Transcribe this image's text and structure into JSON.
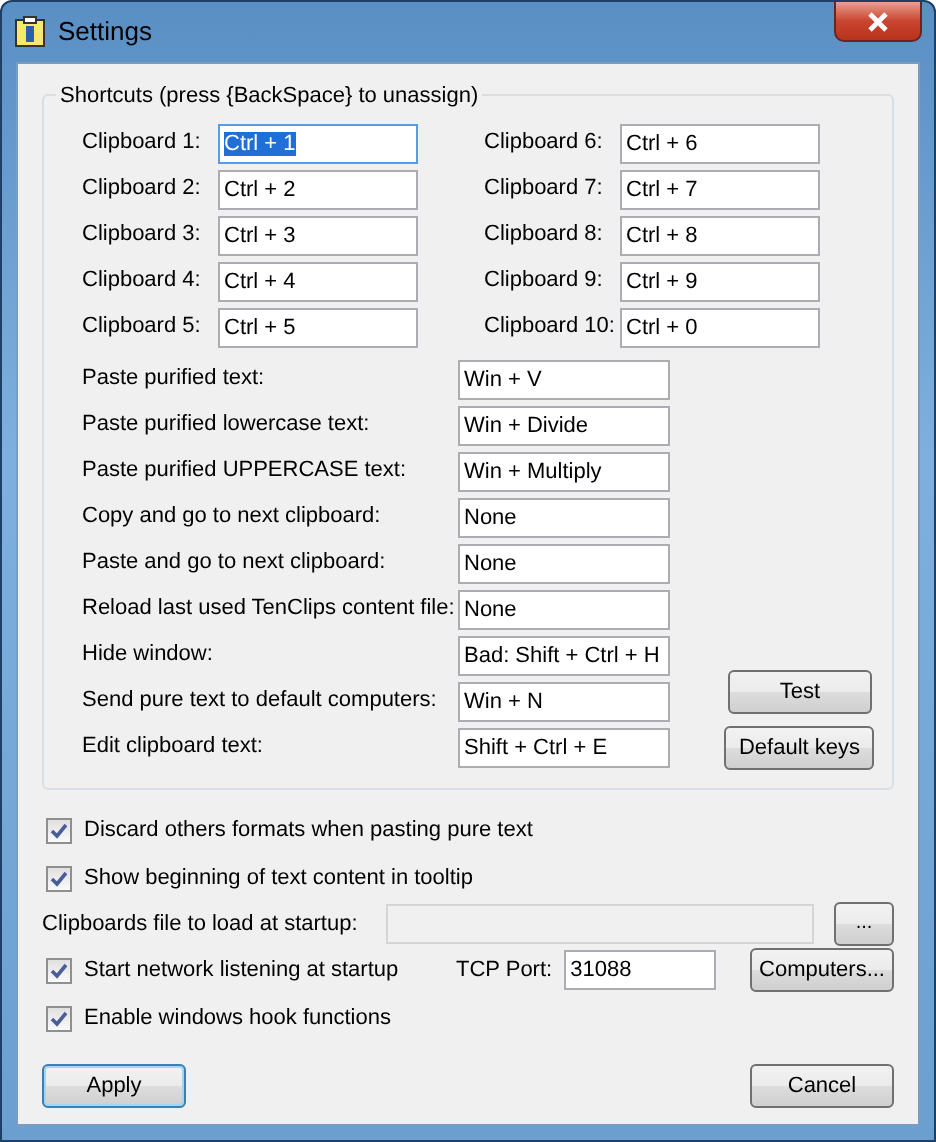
{
  "window": {
    "title": "Settings"
  },
  "shortcuts": {
    "title": "Shortcuts (press {BackSpace} to unassign)",
    "clipboards": [
      {
        "label": "Clipboard 1:",
        "value": "Ctrl + 1",
        "focused": true
      },
      {
        "label": "Clipboard 2:",
        "value": "Ctrl + 2",
        "focused": false
      },
      {
        "label": "Clipboard 3:",
        "value": "Ctrl + 3",
        "focused": false
      },
      {
        "label": "Clipboard 4:",
        "value": "Ctrl + 4",
        "focused": false
      },
      {
        "label": "Clipboard 5:",
        "value": "Ctrl + 5",
        "focused": false
      },
      {
        "label": "Clipboard 6:",
        "value": "Ctrl + 6",
        "focused": false
      },
      {
        "label": "Clipboard 7:",
        "value": "Ctrl + 7",
        "focused": false
      },
      {
        "label": "Clipboard 8:",
        "value": "Ctrl + 8",
        "focused": false
      },
      {
        "label": "Clipboard 9:",
        "value": "Ctrl + 9",
        "focused": false
      },
      {
        "label": "Clipboard 10:",
        "value": "Ctrl + 0",
        "focused": false
      }
    ],
    "actions": [
      {
        "label": "Paste purified text:",
        "value": "Win + V"
      },
      {
        "label": "Paste purified lowercase text:",
        "value": "Win + Divide"
      },
      {
        "label": "Paste purified UPPERCASE text:",
        "value": "Win + Multiply"
      },
      {
        "label": "Copy and go to next clipboard:",
        "value": "None"
      },
      {
        "label": "Paste and go to next clipboard:",
        "value": "None"
      },
      {
        "label": "Reload last used TenClips content file:",
        "value": "None"
      },
      {
        "label": "Hide window:",
        "value": "Bad: Shift + Ctrl + H"
      },
      {
        "label": "Send pure text to default computers:",
        "value": "Win + N"
      },
      {
        "label": "Edit clipboard text:",
        "value": "Shift + Ctrl + E"
      }
    ],
    "buttons": [
      "Test",
      "Default keys"
    ]
  },
  "options": [
    {
      "kind": "checkbox",
      "label": "Discard others formats when pasting pure text",
      "checked": true
    },
    {
      "kind": "checkbox",
      "label": "Show beginning of text content in tooltip",
      "checked": true
    },
    {
      "kind": "file",
      "label": "Clipboards file to load at startup:",
      "disabled": true,
      "button": "..."
    },
    {
      "kind": "network",
      "label": "Start network listening at startup",
      "checked": true,
      "port_label": "TCP Port:",
      "port": "31088",
      "button": "Computers..."
    },
    {
      "kind": "checkbox",
      "label": "Enable windows hook functions",
      "checked": true
    }
  ],
  "footer": [
    {
      "label": "Apply",
      "default": true
    },
    {
      "label": "Cancel",
      "default": false
    }
  ]
}
